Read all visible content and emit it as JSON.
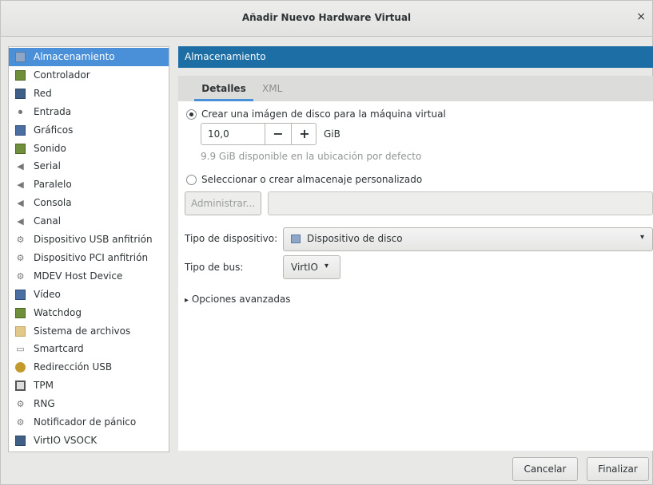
{
  "window": {
    "title": "Añadir Nuevo Hardware Virtual",
    "close_glyph": "×"
  },
  "sidebar": {
    "items": [
      {
        "label": "Almacenamiento",
        "icon": "disk-icon",
        "selected": true
      },
      {
        "label": "Controlador",
        "icon": "card-icon"
      },
      {
        "label": "Red",
        "icon": "network-icon"
      },
      {
        "label": "Entrada",
        "icon": "mouse-icon"
      },
      {
        "label": "Gráficos",
        "icon": "monitor-icon"
      },
      {
        "label": "Sonido",
        "icon": "sound-card-icon"
      },
      {
        "label": "Serial",
        "icon": "serial-port-icon"
      },
      {
        "label": "Paralelo",
        "icon": "parallel-port-icon"
      },
      {
        "label": "Consola",
        "icon": "console-icon"
      },
      {
        "label": "Canal",
        "icon": "channel-icon"
      },
      {
        "label": "Dispositivo USB anfitrión",
        "icon": "usb-host-device-icon"
      },
      {
        "label": "Dispositivo PCI anfitrión",
        "icon": "pci-host-device-icon"
      },
      {
        "label": "MDEV Host Device",
        "icon": "mdev-host-device-icon"
      },
      {
        "label": "Vídeo",
        "icon": "video-icon"
      },
      {
        "label": "Watchdog",
        "icon": "watchdog-icon"
      },
      {
        "label": "Sistema de archivos",
        "icon": "folder-icon"
      },
      {
        "label": "Smartcard",
        "icon": "smartcard-icon"
      },
      {
        "label": "Redirección USB",
        "icon": "usb-redirect-icon"
      },
      {
        "label": "TPM",
        "icon": "tpm-icon"
      },
      {
        "label": "RNG",
        "icon": "rng-icon"
      },
      {
        "label": "Notificador de pánico",
        "icon": "panic-notifier-icon"
      },
      {
        "label": "VirtIO VSOCK",
        "icon": "vsock-icon"
      }
    ]
  },
  "main": {
    "header": "Almacenamiento",
    "tabs": [
      {
        "label": "Detalles",
        "active": true
      },
      {
        "label": "XML",
        "active": false
      }
    ],
    "create_disk_label": "Crear una imágen de disco para la máquina virtual",
    "size_value": "10,0",
    "size_minus": "−",
    "size_plus": "+",
    "size_unit": "GiB",
    "available_hint": "9.9 GiB disponible en la ubicación por defecto",
    "custom_storage_label": "Seleccionar o crear almacenaje personalizado",
    "manage_button": "Administrar...",
    "device_type_label": "Tipo de dispositivo:",
    "device_type_value": "Dispositivo de disco",
    "bus_type_label": "Tipo de bus:",
    "bus_type_value": "VirtIO",
    "advanced_options": "Opciones avanzadas",
    "expander_glyph": "▸",
    "dropdown_glyph": "▾"
  },
  "footer": {
    "cancel_label": "Cancelar",
    "finish_label": "Finalizar"
  },
  "colors": {
    "selection": "#4a90d9",
    "header_bg": "#1c6ea4"
  }
}
